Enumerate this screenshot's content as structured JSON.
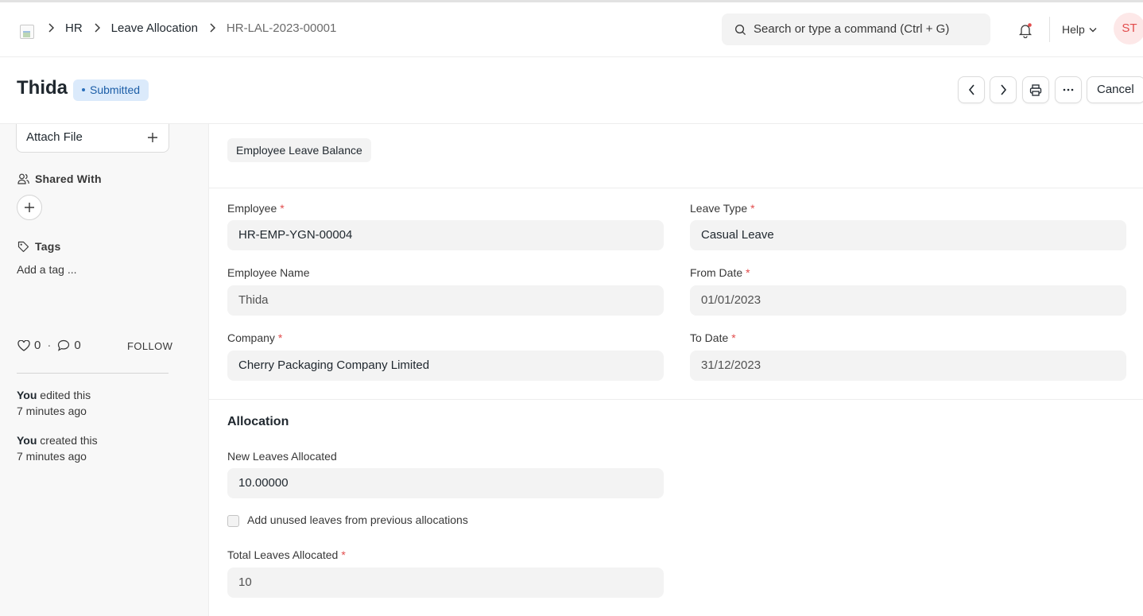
{
  "breadcrumb": [
    "HR",
    "Leave Allocation",
    "HR-LAL-2023-00001"
  ],
  "search": {
    "placeholder": "Search or type a command (Ctrl + G)"
  },
  "navbar": {
    "help_label": "Help",
    "avatar_initials": "ST"
  },
  "page": {
    "title": "Thida",
    "status": "Submitted",
    "cancel_label": "Cancel"
  },
  "sidebar": {
    "attach_label": "Attach File",
    "shared_with_label": "Shared With",
    "tags_label": "Tags",
    "add_tag_label": "Add a tag ...",
    "likes": "0",
    "comments": "0",
    "follow_label": "FOLLOW",
    "activity": [
      {
        "who": "You",
        "what": "edited this",
        "when": "7 minutes ago"
      },
      {
        "who": "You",
        "what": "created this",
        "when": "7 minutes ago"
      }
    ]
  },
  "form": {
    "balance_button": "Employee Leave Balance",
    "fields": {
      "employee": {
        "label": "Employee",
        "value": "HR-EMP-YGN-00004"
      },
      "leave_type": {
        "label": "Leave Type",
        "value": "Casual Leave"
      },
      "employee_name": {
        "label": "Employee Name",
        "value": "Thida"
      },
      "from_date": {
        "label": "From Date",
        "value": "01/01/2023"
      },
      "company": {
        "label": "Company",
        "value": "Cherry Packaging Company Limited"
      },
      "to_date": {
        "label": "To Date",
        "value": "31/12/2023"
      }
    },
    "allocation": {
      "title": "Allocation",
      "new_leaves_label": "New Leaves Allocated",
      "new_leaves_value": "10.00000",
      "carry_forward_label": "Add unused leaves from previous allocations",
      "total_label": "Total Leaves Allocated",
      "total_value": "10"
    }
  },
  "colors": {
    "required": "#e24c4c",
    "status_bg": "#dbeafb",
    "status_text": "#1c5ea7"
  }
}
